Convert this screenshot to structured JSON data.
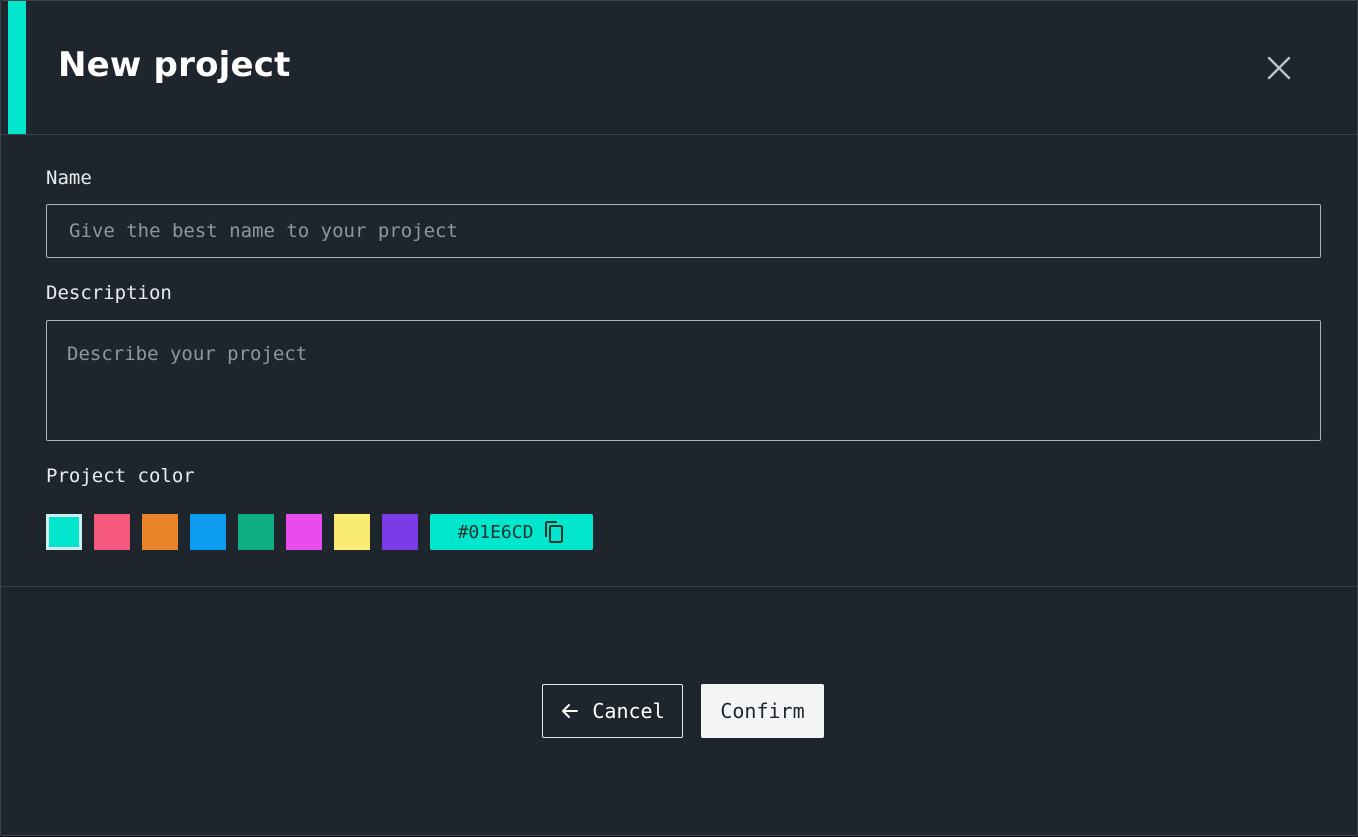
{
  "dialog": {
    "title": "New project",
    "accent_color": "#01E6CD"
  },
  "form": {
    "name": {
      "label": "Name",
      "value": "",
      "placeholder": "Give the best name to your project"
    },
    "description": {
      "label": "Description",
      "value": "",
      "placeholder": "Describe your project"
    },
    "project_color": {
      "label": "Project color",
      "swatches": [
        "#01E6CD",
        "#F4587E",
        "#E8842A",
        "#0E9CF0",
        "#0FAF85",
        "#E94CEC",
        "#FAEC73",
        "#7A3BE6"
      ],
      "selected_index": 0,
      "selected_hex": "#01E6CD"
    }
  },
  "footer": {
    "cancel_label": "Cancel",
    "confirm_label": "Confirm"
  },
  "icons": {
    "close": "close-icon",
    "copy": "copy-icon",
    "back": "arrow-left-icon"
  }
}
